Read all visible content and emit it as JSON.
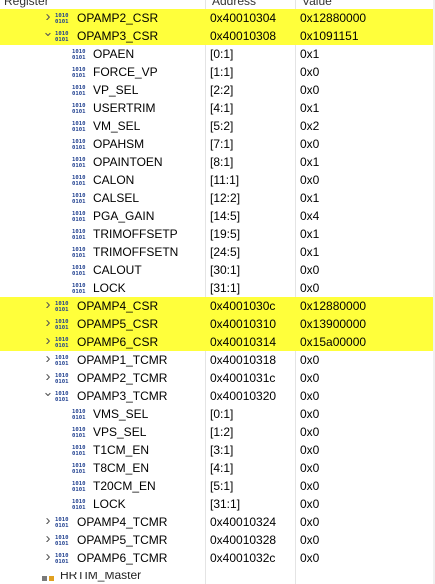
{
  "header": {
    "col_register": "Register",
    "col_address": "Address",
    "col_value": "Value"
  },
  "rows": [
    {
      "name": "OPAMP2_CSR",
      "address": "0x40010304",
      "value": "0x12880000",
      "level": 1,
      "expander": "collapsed",
      "highlight": true
    },
    {
      "name": "OPAMP3_CSR",
      "address": "0x40010308",
      "value": "0x1091151",
      "level": 1,
      "expander": "expanded",
      "highlight": true
    },
    {
      "name": "OPAEN",
      "address": "[0:1]",
      "value": "0x1",
      "level": 2,
      "expander": "none",
      "highlight": false
    },
    {
      "name": "FORCE_VP",
      "address": "[1:1]",
      "value": "0x0",
      "level": 2,
      "expander": "none",
      "highlight": false
    },
    {
      "name": "VP_SEL",
      "address": "[2:2]",
      "value": "0x0",
      "level": 2,
      "expander": "none",
      "highlight": false
    },
    {
      "name": "USERTRIM",
      "address": "[4:1]",
      "value": "0x1",
      "level": 2,
      "expander": "none",
      "highlight": false
    },
    {
      "name": "VM_SEL",
      "address": "[5:2]",
      "value": "0x2",
      "level": 2,
      "expander": "none",
      "highlight": false
    },
    {
      "name": "OPAHSM",
      "address": "[7:1]",
      "value": "0x0",
      "level": 2,
      "expander": "none",
      "highlight": false
    },
    {
      "name": "OPAINTOEN",
      "address": "[8:1]",
      "value": "0x1",
      "level": 2,
      "expander": "none",
      "highlight": false
    },
    {
      "name": "CALON",
      "address": "[11:1]",
      "value": "0x0",
      "level": 2,
      "expander": "none",
      "highlight": false
    },
    {
      "name": "CALSEL",
      "address": "[12:2]",
      "value": "0x1",
      "level": 2,
      "expander": "none",
      "highlight": false
    },
    {
      "name": "PGA_GAIN",
      "address": "[14:5]",
      "value": "0x4",
      "level": 2,
      "expander": "none",
      "highlight": false
    },
    {
      "name": "TRIMOFFSETP",
      "address": "[19:5]",
      "value": "0x1",
      "level": 2,
      "expander": "none",
      "highlight": false
    },
    {
      "name": "TRIMOFFSETN",
      "address": "[24:5]",
      "value": "0x1",
      "level": 2,
      "expander": "none",
      "highlight": false
    },
    {
      "name": "CALOUT",
      "address": "[30:1]",
      "value": "0x0",
      "level": 2,
      "expander": "none",
      "highlight": false
    },
    {
      "name": "LOCK",
      "address": "[31:1]",
      "value": "0x0",
      "level": 2,
      "expander": "none",
      "highlight": false
    },
    {
      "name": "OPAMP4_CSR",
      "address": "0x4001030c",
      "value": "0x12880000",
      "level": 1,
      "expander": "collapsed",
      "highlight": true
    },
    {
      "name": "OPAMP5_CSR",
      "address": "0x40010310",
      "value": "0x13900000",
      "level": 1,
      "expander": "collapsed",
      "highlight": true
    },
    {
      "name": "OPAMP6_CSR",
      "address": "0x40010314",
      "value": "0x15a00000",
      "level": 1,
      "expander": "collapsed",
      "highlight": true
    },
    {
      "name": "OPAMP1_TCMR",
      "address": "0x40010318",
      "value": "0x0",
      "level": 1,
      "expander": "collapsed",
      "highlight": false
    },
    {
      "name": "OPAMP2_TCMR",
      "address": "0x4001031c",
      "value": "0x0",
      "level": 1,
      "expander": "collapsed",
      "highlight": false
    },
    {
      "name": "OPAMP3_TCMR",
      "address": "0x40010320",
      "value": "0x0",
      "level": 1,
      "expander": "expanded",
      "highlight": false
    },
    {
      "name": "VMS_SEL",
      "address": "[0:1]",
      "value": "0x0",
      "level": 2,
      "expander": "none",
      "highlight": false
    },
    {
      "name": "VPS_SEL",
      "address": "[1:2]",
      "value": "0x0",
      "level": 2,
      "expander": "none",
      "highlight": false
    },
    {
      "name": "T1CM_EN",
      "address": "[3:1]",
      "value": "0x0",
      "level": 2,
      "expander": "none",
      "highlight": false
    },
    {
      "name": "T8CM_EN",
      "address": "[4:1]",
      "value": "0x0",
      "level": 2,
      "expander": "none",
      "highlight": false
    },
    {
      "name": "T20CM_EN",
      "address": "[5:1]",
      "value": "0x0",
      "level": 2,
      "expander": "none",
      "highlight": false
    },
    {
      "name": "LOCK",
      "address": "[31:1]",
      "value": "0x0",
      "level": 2,
      "expander": "none",
      "highlight": false
    },
    {
      "name": "OPAMP4_TCMR",
      "address": "0x40010324",
      "value": "0x0",
      "level": 1,
      "expander": "collapsed",
      "highlight": false
    },
    {
      "name": "OPAMP5_TCMR",
      "address": "0x40010328",
      "value": "0x0",
      "level": 1,
      "expander": "collapsed",
      "highlight": false
    },
    {
      "name": "OPAMP6_TCMR",
      "address": "0x4001032c",
      "value": "0x0",
      "level": 1,
      "expander": "collapsed",
      "highlight": false
    }
  ],
  "bottom_row": {
    "name": "HRTIM_Master"
  },
  "colors": {
    "highlight": "#ffff3b",
    "icon_blue": "#1f3f8f",
    "icon_red": "#c0392b"
  },
  "icons": {
    "register": "register-binary-icon",
    "field": "field-binary-icon",
    "collapsed": "chevron-right-icon",
    "expanded": "chevron-down-icon"
  }
}
